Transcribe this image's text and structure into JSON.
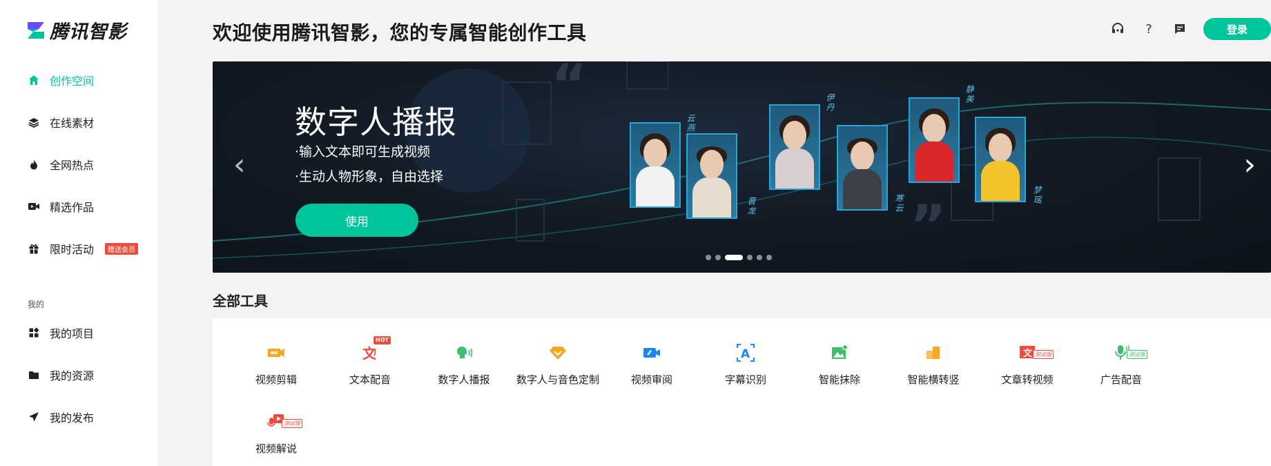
{
  "brand": {
    "name": "腾讯智影"
  },
  "sidebar": {
    "items": [
      {
        "label": "创作空间",
        "icon": "home-icon",
        "active": true
      },
      {
        "label": "在线素材",
        "icon": "layers-icon"
      },
      {
        "label": "全网热点",
        "icon": "flame-icon"
      },
      {
        "label": "精选作品",
        "icon": "video-camera-icon"
      },
      {
        "label": "限时活动",
        "icon": "gift-icon",
        "badge": "赠送会员"
      }
    ],
    "section_label": "我的",
    "my_items": [
      {
        "label": "我的项目",
        "icon": "grid-icon"
      },
      {
        "label": "我的资源",
        "icon": "folder-icon"
      },
      {
        "label": "我的发布",
        "icon": "send-icon"
      }
    ]
  },
  "header": {
    "title": "欢迎使用腾讯智影，您的专属智能创作工具",
    "icons": [
      "headset-icon",
      "help-icon",
      "message-icon"
    ],
    "help_glyph": "?",
    "login_label": "登录"
  },
  "banner": {
    "title": "数字人播报",
    "lines": [
      "·输入文本即可生成视频",
      "·生动人物形象，自由选择"
    ],
    "button_label": "使用",
    "presenter_names": [
      "云燕",
      "晋龙",
      "伊丹",
      "寒云",
      "静美",
      "梦瑶"
    ],
    "slide_count": 6,
    "active_slide": 2,
    "arrow_left": "‹",
    "arrow_right": "›"
  },
  "tools": {
    "heading": "全部工具",
    "hot_tag": "HOT",
    "test_tag": "测试版",
    "items": [
      {
        "label": "视频剪辑",
        "icon": "scissors-icon",
        "color": "#f7a823"
      },
      {
        "label": "文本配音",
        "icon": "text-voice-icon",
        "color": "#f04a3a",
        "tag": "HOT"
      },
      {
        "label": "数字人播报",
        "icon": "digital-human-icon",
        "color": "#3fbf6b"
      },
      {
        "label": "数字人与音色定制",
        "icon": "diamond-icon",
        "color": "#f7a823"
      },
      {
        "label": "视频审阅",
        "icon": "review-camera-icon",
        "color": "#1d87f0"
      },
      {
        "label": "字幕识别",
        "icon": "subtitle-icon",
        "color": "#1d87f0"
      },
      {
        "label": "智能抹除",
        "icon": "image-erase-icon",
        "color": "#3fbf6b"
      },
      {
        "label": "智能横转竖",
        "icon": "rotate-icon",
        "color": "#f7a823"
      },
      {
        "label": "文章转视频",
        "icon": "article-video-icon",
        "color": "#f04a3a",
        "tag": "测试版"
      },
      {
        "label": "广告配音",
        "icon": "microphone-icon",
        "color": "#3fbf6b",
        "tag": "测试版"
      },
      {
        "label": "视频解说",
        "icon": "video-narration-icon",
        "color": "#f04a3a",
        "tag": "测试版"
      }
    ]
  },
  "colors": {
    "accent": "#00c49a",
    "badge": "#f04a3a"
  }
}
